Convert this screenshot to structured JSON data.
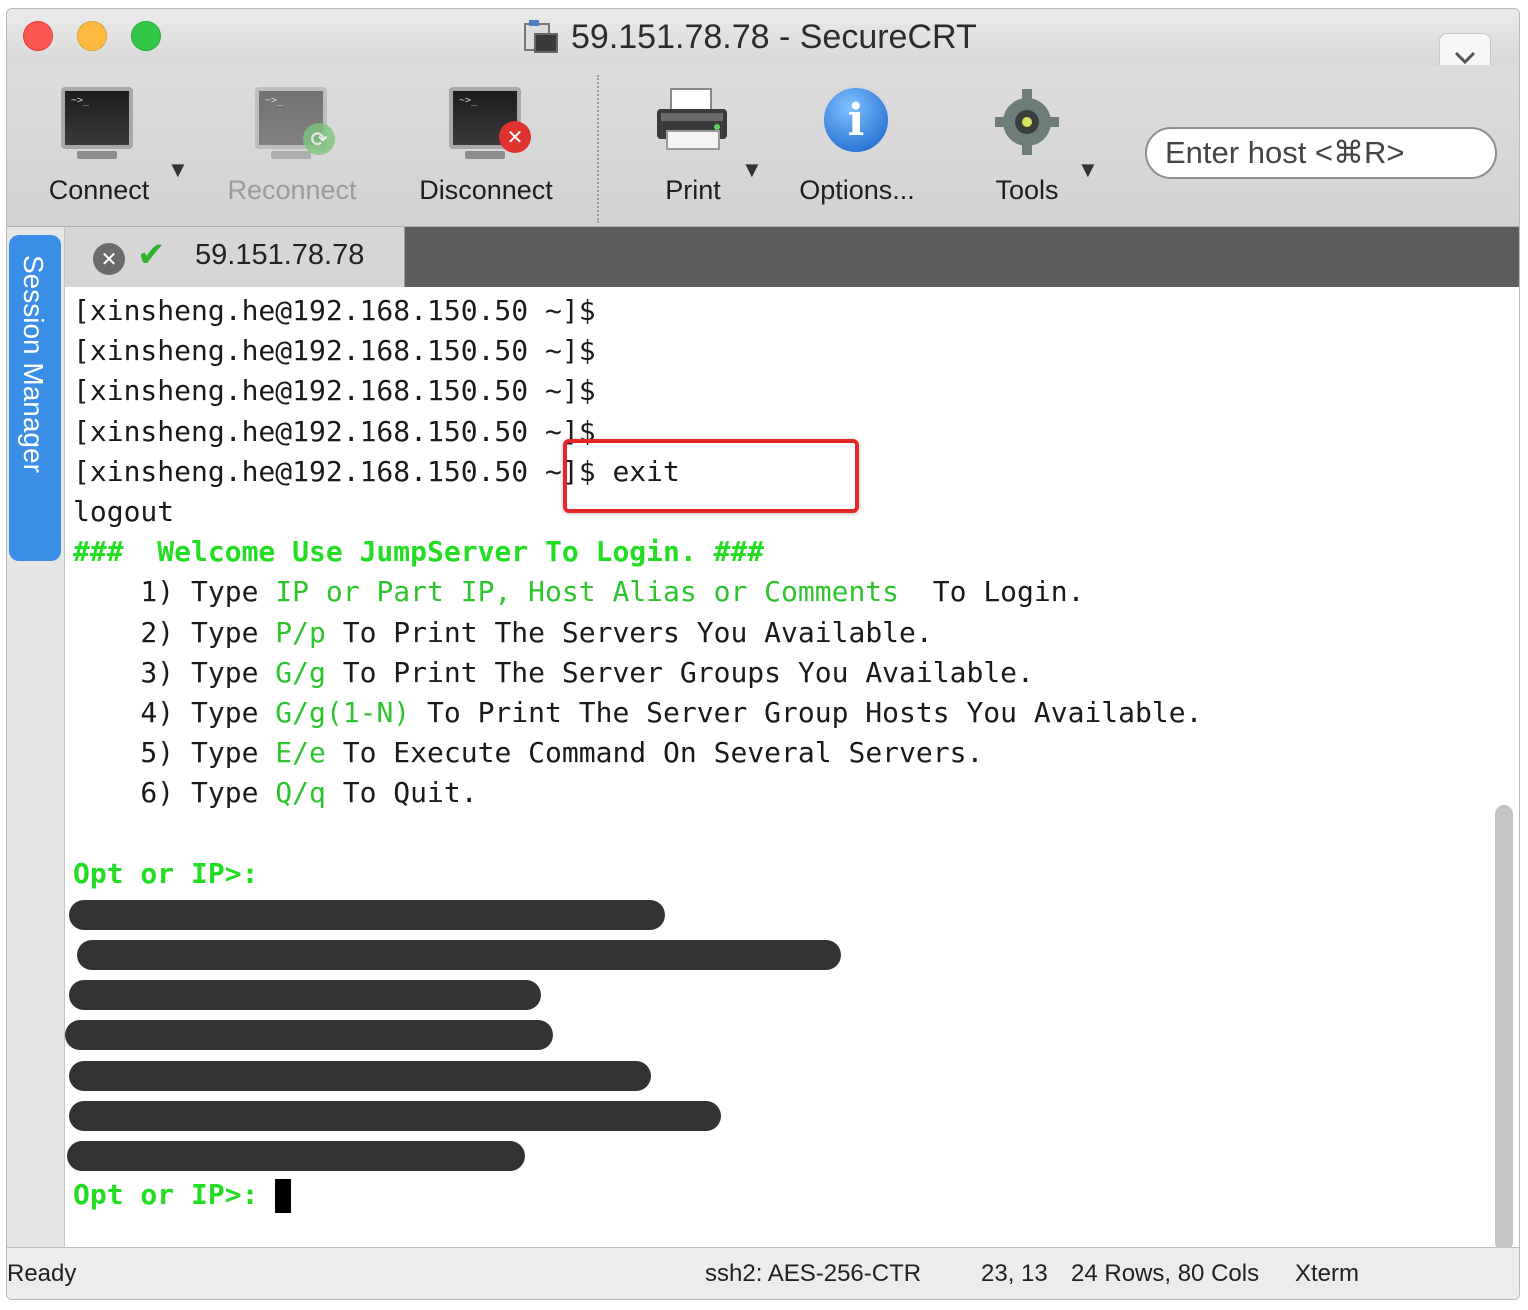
{
  "window": {
    "title": "59.151.78.78 - SecureCRT",
    "collapse_icon": "chevron-down-icon"
  },
  "toolbar": {
    "connect": "Connect",
    "reconnect": "Reconnect",
    "disconnect": "Disconnect",
    "print": "Print",
    "options": "Options...",
    "tools": "Tools",
    "host_placeholder": "Enter host <⌘R>"
  },
  "tab": {
    "label": "59.151.78.78",
    "status_icon": "checkmark-icon",
    "close_icon": "close-icon"
  },
  "side": {
    "session_manager": "Session Manager"
  },
  "terminal": {
    "prompts": [
      "[xinsheng.he@192.168.150.50 ~]$",
      "[xinsheng.he@192.168.150.50 ~]$",
      "[xinsheng.he@192.168.150.50 ~]$",
      "[xinsheng.he@192.168.150.50 ~]$"
    ],
    "exit_prompt": "[xinsheng.he@192.168.150.50 ~]$ exit",
    "logout": "logout",
    "welcome": "###  Welcome Use JumpServer To Login. ###",
    "menu": [
      {
        "num": "    1) Type ",
        "key": "IP or Part IP, Host Alias or Comments",
        "rest": "  To Login."
      },
      {
        "num": "    2) Type ",
        "key": "P/p",
        "rest": " To Print The Servers You Available."
      },
      {
        "num": "    3) Type ",
        "key": "G/g",
        "rest": " To Print The Server Groups You Available."
      },
      {
        "num": "    4) Type ",
        "key": "G/g(1-N)",
        "rest": " To Print The Server Group Hosts You Available."
      },
      {
        "num": "    5) Type ",
        "key": "E/e",
        "rest": " To Execute Command On Several Servers."
      },
      {
        "num": "    6) Type ",
        "key": "Q/q",
        "rest": " To Quit."
      }
    ],
    "opt_prompt": "Opt or IP>:",
    "opt_prompt_final": "Opt or IP>: "
  },
  "status": {
    "ready": "Ready",
    "cipher": "ssh2: AES-256-CTR",
    "position": "23, 13",
    "size": "24 Rows, 80 Cols",
    "term": "Xterm"
  },
  "colors": {
    "prompt_green": "#22dd22",
    "highlight_red": "#e8262a",
    "session_blue": "#3a8ee6"
  }
}
